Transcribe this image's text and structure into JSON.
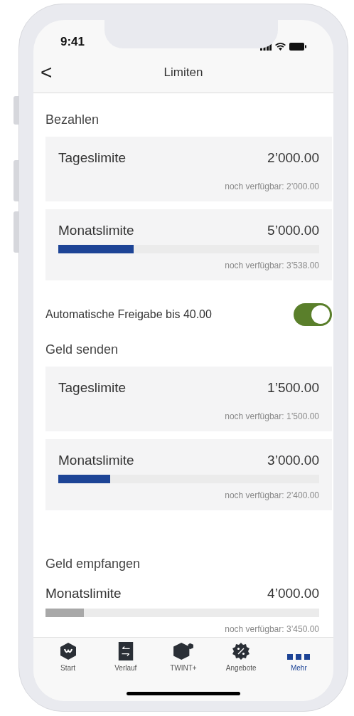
{
  "status_bar": {
    "time": "9:41"
  },
  "nav": {
    "back": "<",
    "title": "Limiten"
  },
  "sections": [
    {
      "title": "Bezahlen",
      "limits": [
        {
          "kind": "card",
          "label": "Tageslimite",
          "amount": "2’000.00",
          "available": "noch verfügbar: 2’000.00"
        },
        {
          "kind": "card",
          "label": "Monatslimite",
          "amount": "5’000.00",
          "level": 0.29,
          "available": "noch verfügbar: 3’538.00"
        }
      ],
      "toggle": {
        "label": "Automatische Freigabe bis 40.00",
        "on": true
      }
    },
    {
      "title": "Geld senden",
      "limits": [
        {
          "kind": "card",
          "label": "Tageslimite",
          "amount": "1’500.00",
          "available": "noch verfügbar: 1’500.00"
        },
        {
          "kind": "card",
          "label": "Monatslimite",
          "amount": "3’000.00",
          "level": 0.2,
          "available": "noch verfügbar: 2’400.00"
        }
      ]
    },
    {
      "title": "Geld empfangen",
      "limits": [
        {
          "kind": "plain",
          "label": "Monatslimite",
          "amount": "4’000.00",
          "level": 0.14,
          "available": "noch verfügbar: 3’450.00"
        }
      ]
    }
  ],
  "tab_bar": [
    {
      "label": "Start",
      "selected": false
    },
    {
      "label": "Verlauf",
      "selected": false
    },
    {
      "label": "TWINT+",
      "selected": false
    },
    {
      "label": "Angebote",
      "selected": false
    },
    {
      "label": "Mehr",
      "selected": true
    }
  ]
}
